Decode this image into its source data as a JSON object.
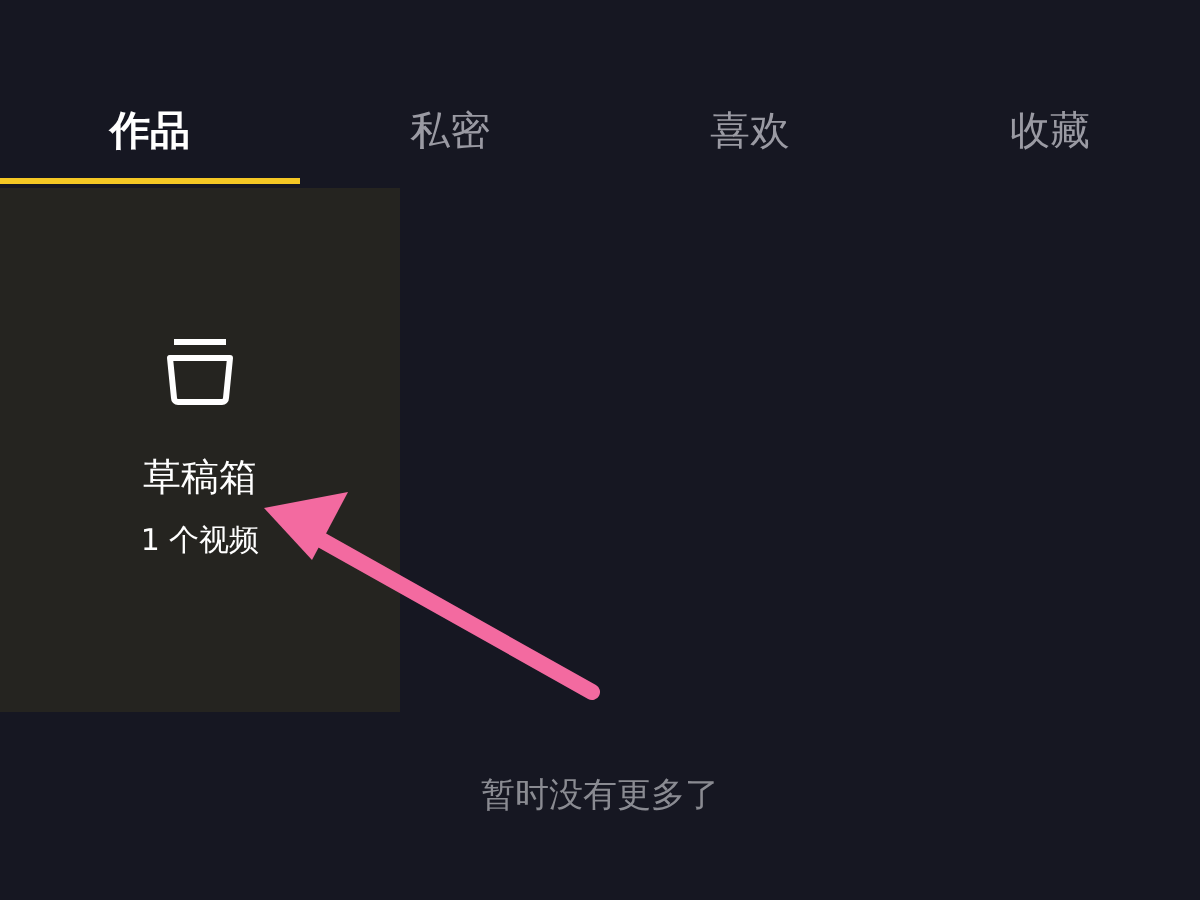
{
  "tabs": [
    {
      "label": "作品",
      "selected": true
    },
    {
      "label": "私密",
      "selected": false
    },
    {
      "label": "喜欢",
      "selected": false
    },
    {
      "label": "收藏",
      "selected": false
    }
  ],
  "drafts": {
    "title": "草稿箱",
    "count": "1 个视频"
  },
  "footer": "暂时没有更多了"
}
